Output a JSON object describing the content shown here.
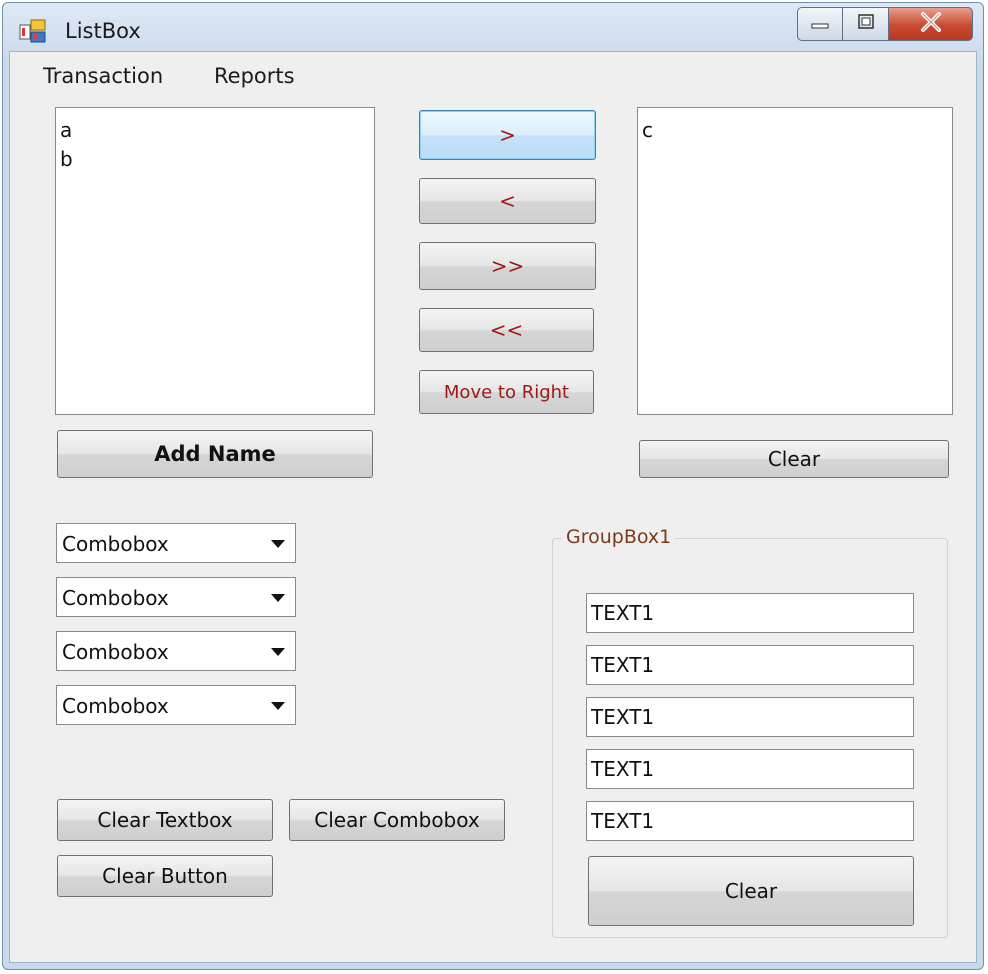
{
  "window": {
    "title": "ListBox"
  },
  "menu": [
    {
      "label": "Transaction"
    },
    {
      "label": "Reports"
    }
  ],
  "left_list": {
    "items": [
      "a",
      "b"
    ]
  },
  "right_list": {
    "items": [
      "c"
    ]
  },
  "transfer_buttons": [
    {
      "label": ">"
    },
    {
      "label": "<"
    },
    {
      "label": ">>"
    },
    {
      "label": "<<"
    },
    {
      "label": "Move to Right"
    }
  ],
  "add_name_button": "Add Name",
  "right_clear_button": "Clear",
  "combos": [
    {
      "value": "Combobox"
    },
    {
      "value": "Combobox"
    },
    {
      "value": "Combobox"
    },
    {
      "value": "Combobox"
    }
  ],
  "bottom_buttons": {
    "clear_textbox": "Clear Textbox",
    "clear_combobox": "Clear Combobox",
    "clear_button": "Clear Button"
  },
  "groupbox": {
    "title": "GroupBox1",
    "textboxes": [
      "TEXT1",
      "TEXT1",
      "TEXT1",
      "TEXT1",
      "TEXT1"
    ],
    "clear_label": "Clear"
  },
  "colors": {
    "accent_text": "#a01818",
    "focus_border": "#3c7fb1",
    "group_label": "#7a3a1e"
  },
  "icons": {
    "app": "windows-form-icon",
    "minimize": "minimize-icon",
    "maximize": "maximize-icon",
    "close": "close-icon"
  }
}
